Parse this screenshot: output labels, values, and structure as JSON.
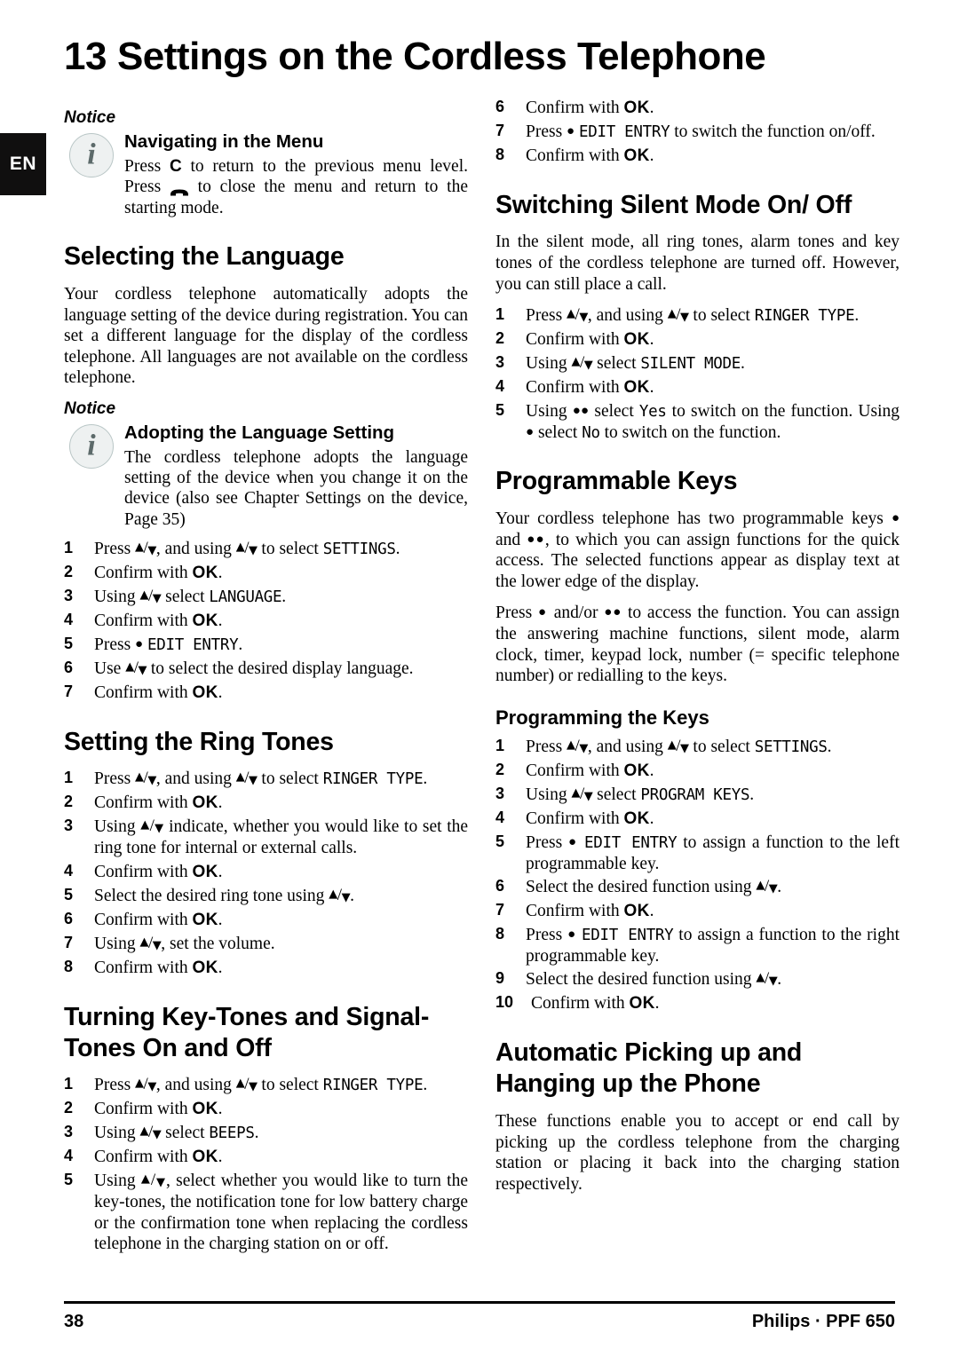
{
  "chapter": {
    "number": "13",
    "title": "Settings on the Cordless Telephone"
  },
  "language_tab": "EN",
  "left_column": {
    "notice_1": {
      "label": "Notice",
      "title": "Navigating in the Menu",
      "body_part_1": "Press ",
      "key_c": "C",
      "body_part_2": " to return to the previous menu level. Press ",
      "body_part_3": " to close the menu and return to the starting mode."
    },
    "heading_language": "Selecting the Language",
    "para_language": "Your cordless telephone automatically adopts the language setting of the device during registration. You can set a different language for the display of the cordless telephone. All languages are not available on the cordless telephone.",
    "notice_2": {
      "label": "Notice",
      "title": "Adopting the Language Setting",
      "body": "The cordless telephone adopts the language setting of the device when you change it on the device (also see Chapter Settings on the device, Page 35)"
    },
    "steps_language": [
      {
        "n": "1",
        "pre": "Press ",
        "arrows": true,
        "mid": ", and using ",
        "arrows2": true,
        "post": " to select ",
        "lcd": "SETTINGS",
        "tail": "."
      },
      {
        "n": "2",
        "pre": "Confirm with ",
        "ok": "OK",
        "tail": "."
      },
      {
        "n": "3",
        "pre": "Using ",
        "arrows": true,
        "post": " select ",
        "lcd": "LANGUAGE",
        "tail": "."
      },
      {
        "n": "4",
        "pre": "Confirm with ",
        "ok": "OK",
        "tail": "."
      },
      {
        "n": "5",
        "pre": "Press ",
        "dot": "1",
        "post": " ",
        "lcd": "EDIT ENTRY",
        "tail": "."
      },
      {
        "n": "6",
        "pre": "Use ",
        "arrows": true,
        "post": " to select the desired display language.",
        "tail": ""
      },
      {
        "n": "7",
        "pre": "Confirm with ",
        "ok": "OK",
        "tail": "."
      }
    ],
    "heading_ring_tones": "Setting the Ring Tones",
    "steps_ring_tones": [
      {
        "n": "1",
        "pre": "Press ",
        "arrows": true,
        "mid": ", and using ",
        "arrows2": true,
        "post": " to select ",
        "lcd": "RINGER TYPE",
        "tail": "."
      },
      {
        "n": "2",
        "pre": "Confirm with ",
        "ok": "OK",
        "tail": "."
      },
      {
        "n": "3",
        "pre": "Using ",
        "arrows": true,
        "post": " indicate, whether you would like to set the ring tone for internal or external calls.",
        "tail": ""
      },
      {
        "n": "4",
        "pre": "Confirm with ",
        "ok": "OK",
        "tail": "."
      },
      {
        "n": "5",
        "pre": "Select the desired ring tone using ",
        "arrows": true,
        "post": "",
        "tail": "."
      },
      {
        "n": "6",
        "pre": "Confirm with ",
        "ok": "OK",
        "tail": "."
      },
      {
        "n": "7",
        "pre": "Using ",
        "arrows": true,
        "post": ", set the volume.",
        "tail": ""
      },
      {
        "n": "8",
        "pre": "Confirm with ",
        "ok": "OK",
        "tail": "."
      }
    ],
    "heading_key_tones": "Turning Key-Tones and Signal-Tones On and Off",
    "steps_key_tones": [
      {
        "n": "1",
        "pre": "Press ",
        "arrows": true,
        "mid": ", and using ",
        "arrows2": true,
        "post": " to select ",
        "lcd": "RINGER TYPE",
        "tail": "."
      },
      {
        "n": "2",
        "pre": "Confirm with ",
        "ok": "OK",
        "tail": "."
      },
      {
        "n": "3",
        "pre": "Using ",
        "arrows": true,
        "post": " select ",
        "lcd": "BEEPS",
        "tail": "."
      },
      {
        "n": "4",
        "pre": "Confirm with ",
        "ok": "OK",
        "tail": "."
      },
      {
        "n": "5",
        "pre": "Using ",
        "arrows": true,
        "post": ", select whether you would like to turn the key-tones, the notification tone for low battery charge or the confirmation tone when replacing the cordless telephone in the charging station on or off.",
        "tail": ""
      }
    ]
  },
  "right_column": {
    "steps_continued": [
      {
        "n": "6",
        "pre": "Confirm with ",
        "ok": "OK",
        "tail": "."
      },
      {
        "n": "7",
        "pre": "Press ",
        "dot": "1",
        "post": " ",
        "lcd": "EDIT ENTRY",
        "tail": " to switch the function on/off."
      },
      {
        "n": "8",
        "pre": "Confirm with ",
        "ok": "OK",
        "tail": "."
      }
    ],
    "heading_silent_mode": "Switching Silent Mode On/ Off",
    "para_silent_mode": "In the silent mode, all ring tones, alarm tones and key tones of the cordless telephone are turned off. However, you can still place a call.",
    "steps_silent_mode": [
      {
        "n": "1",
        "pre": "Press ",
        "arrows": true,
        "mid": ", and using ",
        "arrows2": true,
        "post": " to select ",
        "lcd": "RINGER TYPE",
        "tail": "."
      },
      {
        "n": "2",
        "pre": "Confirm with ",
        "ok": "OK",
        "tail": "."
      },
      {
        "n": "3",
        "pre": "Using ",
        "arrows": true,
        "post": " select ",
        "lcd": "SILENT MODE",
        "tail": "."
      },
      {
        "n": "4",
        "pre": "Confirm with ",
        "ok": "OK",
        "tail": "."
      },
      {
        "n": "5",
        "pre": "Using ",
        "dot": "2",
        "post": " select ",
        "lcd": "Yes",
        "tail": " to switch on the function. Using ",
        "dot_b": "1",
        "post_b": " select ",
        "lcd_b": "No",
        "tail_b": " to switch on the function."
      }
    ],
    "heading_programmable_keys": "Programmable Keys",
    "para_prog_1_a": "Your cordless telephone has two programmable keys ",
    "para_prog_1_b": " and ",
    "para_prog_1_c": ", to which you can assign functions for the quick access. The selected functions appear as display text at the lower edge of the display.",
    "para_prog_2_a": "Press ",
    "para_prog_2_b": " and/or ",
    "para_prog_2_c": " to access the function. You can assign the answering machine functions, silent mode, alarm clock, timer, keypad lock, number (= specific telephone number) or redialling to the keys.",
    "heading_programming_keys": "Programming the Keys",
    "steps_programming": [
      {
        "n": "1",
        "pre": "Press ",
        "arrows": true,
        "mid": ", and using ",
        "arrows2": true,
        "post": " to select ",
        "lcd": "SETTINGS",
        "tail": "."
      },
      {
        "n": "2",
        "pre": "Confirm with ",
        "ok": "OK",
        "tail": "."
      },
      {
        "n": "3",
        "pre": "Using ",
        "arrows": true,
        "post": " select ",
        "lcd": "PROGRAM KEYS",
        "tail": "."
      },
      {
        "n": "4",
        "pre": "Confirm with ",
        "ok": "OK",
        "tail": "."
      },
      {
        "n": "5",
        "pre": "Press ",
        "dot": "1",
        "post": " ",
        "lcd": "EDIT ENTRY",
        "tail": " to assign a function to the left programmable key."
      },
      {
        "n": "6",
        "pre": "Select the desired function using ",
        "arrows": true,
        "post": "",
        "tail": "."
      },
      {
        "n": "7",
        "pre": "Confirm with ",
        "ok": "OK",
        "tail": "."
      },
      {
        "n": "8",
        "pre": "Press ",
        "dot": "1",
        "post": " ",
        "lcd": "EDIT ENTRY",
        "tail": " to assign a function to the right programmable key."
      },
      {
        "n": "9",
        "pre": "Select the desired function using ",
        "arrows": true,
        "post": "",
        "tail": "."
      },
      {
        "n": "10",
        "pre": "Confirm with ",
        "ok": "OK",
        "tail": "."
      }
    ],
    "heading_automatic": "Automatic Picking up and Hanging up the Phone",
    "para_automatic": "These functions enable you to accept or end call by picking up the cordless telephone from the charging station or placing it back into the charging station respectively."
  },
  "footer": {
    "page_number": "38",
    "brand": "Philips · PPF 650"
  }
}
